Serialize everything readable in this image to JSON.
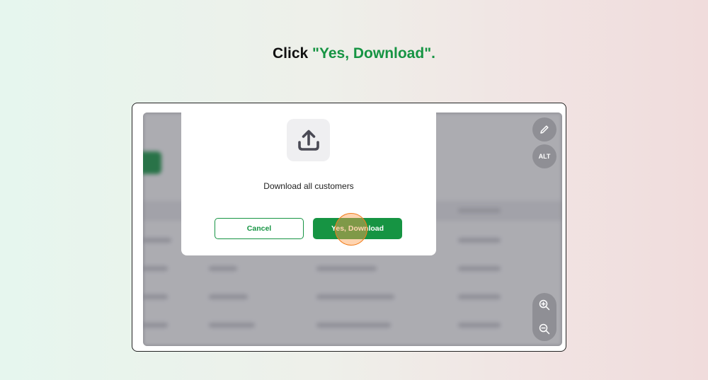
{
  "instruction": {
    "prefix": "Click ",
    "highlight": "\"Yes, Download\"."
  },
  "modal": {
    "icon": "upload-icon",
    "message": "Download all customers",
    "cancel_label": "Cancel",
    "confirm_label": "Yes, Download"
  },
  "toolbar": {
    "edit_icon": "pencil-icon",
    "alt_label": "ALT",
    "zoom_in_icon": "zoom-in-icon",
    "zoom_out_icon": "zoom-out-icon"
  },
  "colors": {
    "accent": "#169443",
    "click_highlight": "#f07d1c"
  }
}
